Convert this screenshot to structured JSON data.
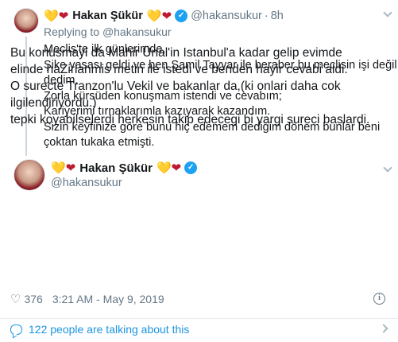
{
  "parent_tweet": {
    "name": "Hakan Şükür",
    "handle": "@hakansukur",
    "separator": "·",
    "time": "8h",
    "reply_prefix": "Replying to",
    "reply_handle": "@hakansukur",
    "lines": [
      "Meclis'te ilk günlerimde,",
      "Şike yasası geldi ve ben Şamil Tayyar ile beraber bu meclisin işi değil",
      "dedim.",
      "Zorla kürsüden konuşmam istendi ve cevabım;",
      "Kariyerimi tırnaklarımla kazıyarak kazandım.",
      "Sizin keyfinize göre bunu hiç edemem dediğim dönem bunlar beni",
      "çoktan tukaka etmişti."
    ]
  },
  "main_tweet": {
    "name": "Hakan Şükür",
    "handle": "@hakansukur",
    "lines": [
      "Bu konusmayi da Mahir Ünal'in Istanbul'a kadar gelip evimde",
      "elinde haZirlanmis metin ile istedi ve benden hayir cevabi aldi.",
      "O surecte Tranzon'lu Vekil ve bakanlar da,(ki onlari daha cok",
      "ilgilendiriyordu.)",
      "tepki koyabilselerdi herkesin takip edecegi bi yargi sureci baslardi."
    ],
    "like_count": "376",
    "timestamp": "3:21 AM - May 9, 2019"
  },
  "footer": {
    "talking_label": "122 people are talking about this"
  },
  "icons": {
    "heart_gold": "💛",
    "heart_red": "❤",
    "verified": "✓",
    "like": "♡",
    "info": "i"
  },
  "colors": {
    "accent": "#1da1f2",
    "link": "#1b95e0",
    "muted": "#657786",
    "text": "#14171a"
  }
}
